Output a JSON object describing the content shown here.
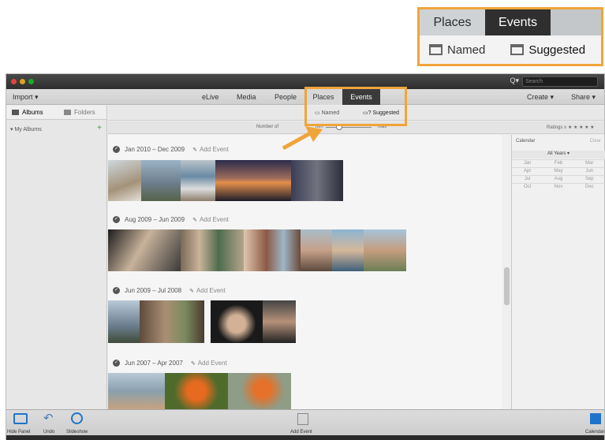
{
  "callout": {
    "tabs": [
      "Places",
      "Events"
    ],
    "named": "Named",
    "suggested": "Suggested",
    "suggested_prefix": "?"
  },
  "window": {
    "search_placeholder": "Search",
    "import": "Import",
    "nav": [
      "eLive",
      "Media",
      "People",
      "Places",
      "Events"
    ],
    "create": "Create",
    "share": "Share",
    "left_tabs": [
      "Albums",
      "Folders"
    ],
    "my_albums": "My Albums",
    "sub_named": "Named",
    "sub_suggested": "Suggested",
    "number_of": "Number of",
    "min": "Min",
    "max": "Max",
    "ratings": "Ratings",
    "calendar": "Calendar",
    "clear": "Clear",
    "all_years": "All Years",
    "months": [
      [
        "Jan",
        "Feb",
        "Mar"
      ],
      [
        "Apr",
        "May",
        "Jun"
      ],
      [
        "Jul",
        "Aug",
        "Sep"
      ],
      [
        "Oct",
        "Nov",
        "Dec"
      ]
    ]
  },
  "events": [
    {
      "title": "Jan 2010 – Dec 2009",
      "add": "Add Event"
    },
    {
      "title": "Aug 2009 – Jun 2009",
      "add": "Add Event"
    },
    {
      "title": "Jun 2009 – Jul 2008",
      "add": "Add Event"
    },
    {
      "title": "Jun 2007 – Apr 2007",
      "add": "Add Event"
    }
  ],
  "bottom": {
    "hide_panel": "Hide Panel",
    "undo": "Undo",
    "slideshow": "Slideshow",
    "add_event": "Add Event",
    "calendar": "Calendar"
  },
  "colors": {
    "highlight": "#f0a53a",
    "active_tab": "#2f2f2f"
  }
}
